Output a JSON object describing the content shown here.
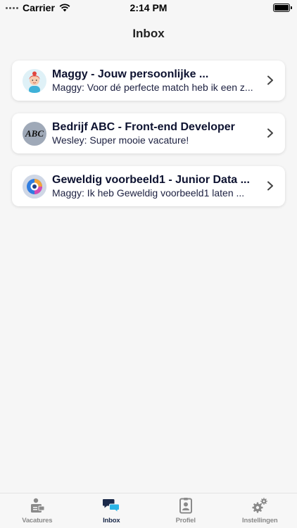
{
  "status_bar": {
    "carrier": "Carrier",
    "time": "2:14 PM"
  },
  "nav": {
    "title": "Inbox"
  },
  "conversations": [
    {
      "title": "Maggy - Jouw persoonlijke ...",
      "preview": "Maggy: Voor dé perfecte match heb ik een z...",
      "avatar": "maggy-avatar"
    },
    {
      "title": "Bedrijf ABC - Front-end Developer",
      "preview": "Wesley: Super mooie vacature!",
      "avatar_text": "ABC"
    },
    {
      "title": "Geweldig voorbeeld1 - Junior Data ...",
      "preview": "Maggy: Ik heb Geweldig voorbeeld1 laten ...",
      "avatar": "company-logo"
    }
  ],
  "tabs": [
    {
      "label": "Vacatures",
      "icon": "vacatures-icon",
      "active": false
    },
    {
      "label": "Inbox",
      "icon": "chat-bubbles-icon",
      "active": true
    },
    {
      "label": "Profiel",
      "icon": "id-badge-icon",
      "active": false
    },
    {
      "label": "Instellingen",
      "icon": "gears-icon",
      "active": false
    }
  ],
  "colors": {
    "accent": "#2bb5e6",
    "navy": "#0d1230",
    "tab_inactive": "#8a8a8a"
  }
}
